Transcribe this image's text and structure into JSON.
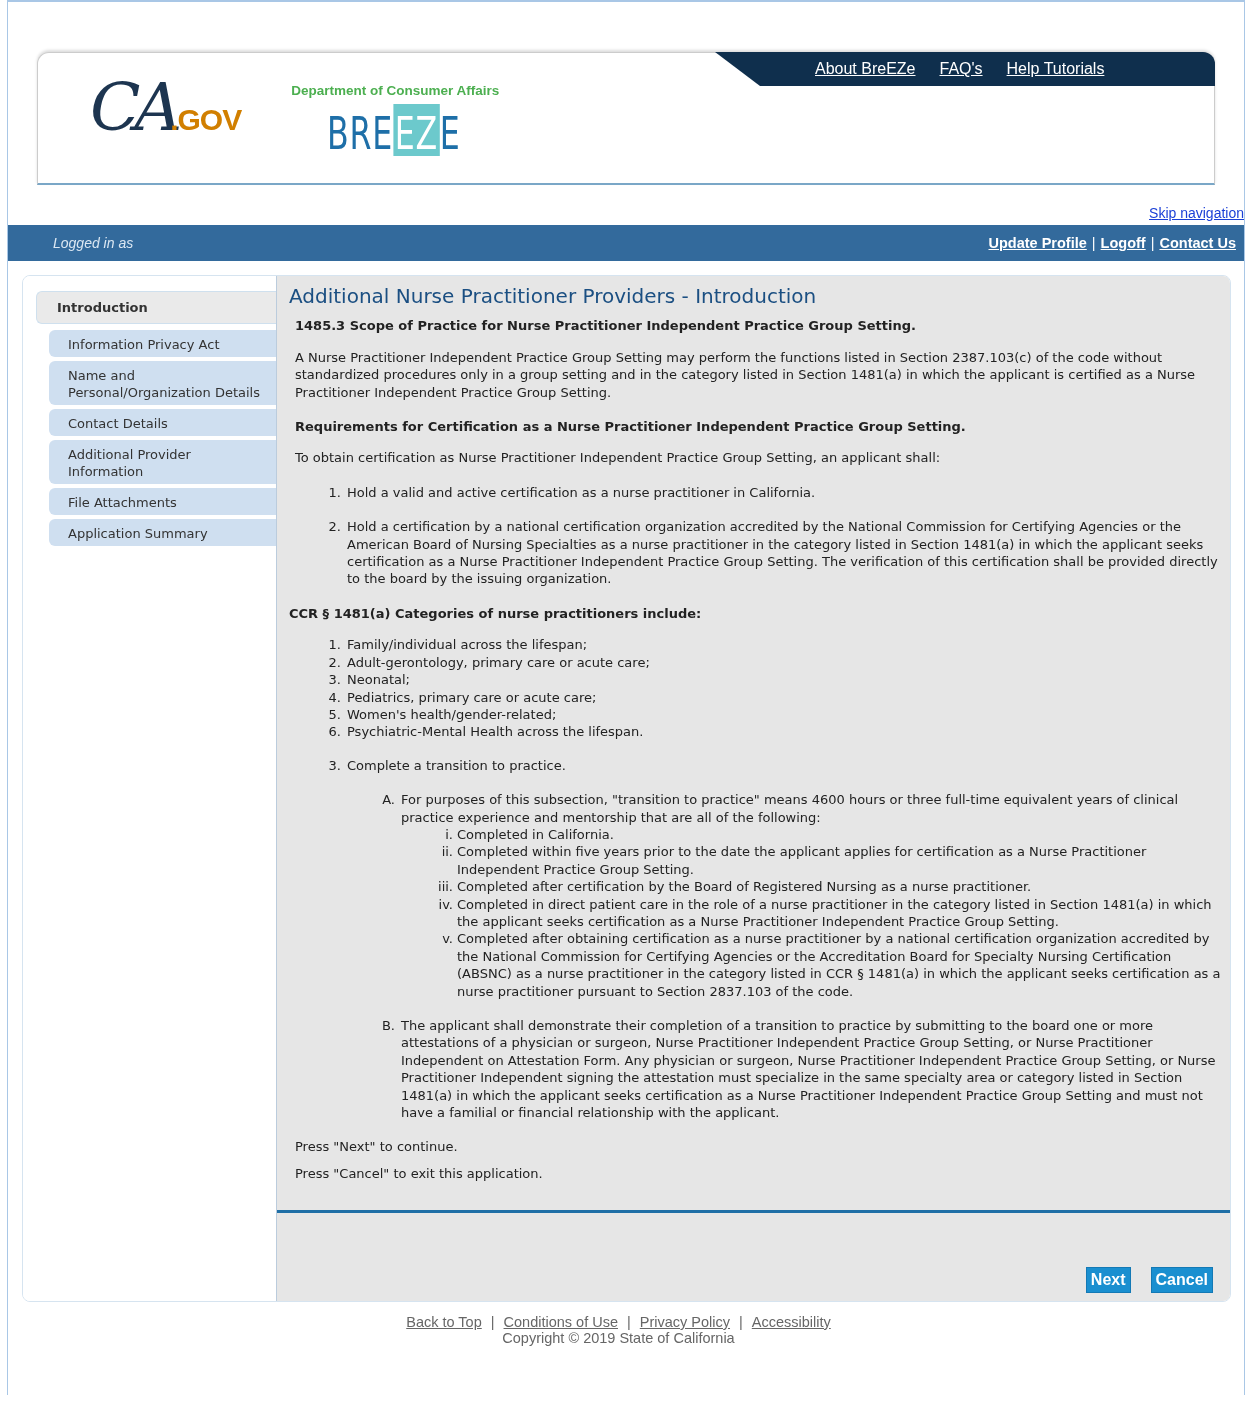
{
  "header": {
    "nav_links": [
      "About BreEZe",
      "FAQ's",
      "Help Tutorials"
    ],
    "ca_logo": {
      "script": "CA",
      "suffix": ".GOV"
    },
    "department": "Department of Consumer Affairs",
    "breeze_logo": {
      "left": "BRE",
      "middle": "EZ",
      "right": "E"
    }
  },
  "skip_link": "Skip navigation",
  "user_bar": {
    "logged_in": "Logged in as",
    "links": [
      "Update Profile",
      "Logoff",
      "Contact Us"
    ],
    "separator": "|"
  },
  "sidebar": {
    "items": [
      {
        "label": "Introduction",
        "selected": true
      },
      {
        "label": "Information Privacy Act",
        "selected": false
      },
      {
        "label": "Name and Personal/Organization Details",
        "selected": false
      },
      {
        "label": "Contact Details",
        "selected": false
      },
      {
        "label": "Additional Provider Information",
        "selected": false
      },
      {
        "label": "File Attachments",
        "selected": false
      },
      {
        "label": "Application Summary",
        "selected": false
      }
    ]
  },
  "content": {
    "title": "Additional Nurse Practitioner Providers - Introduction",
    "scope_heading": "1485.3 Scope of Practice for Nurse Practitioner Independent Practice Group Setting.",
    "scope_text": "A Nurse Practitioner Independent Practice Group Setting may perform the functions listed in Section 2387.103(c) of the code without standardized procedures only in a group setting and in the category listed in Section 1481(a) in which the applicant is certified as a Nurse Practitioner Independent Practice Group Setting.",
    "requirements_heading": "Requirements for Certification as a Nurse Practitioner Independent Practice Group Setting.",
    "requirements_intro": "To obtain certification as Nurse Practitioner Independent Practice Group Setting, an applicant shall:",
    "requirements": [
      {
        "marker": "1.",
        "text": "Hold a valid and active certification as a nurse practitioner in California."
      },
      {
        "marker": "2.",
        "text": "Hold a certification by a national certification organization accredited by the National Commission for Certifying Agencies or the American Board of Nursing Specialties as a nurse practitioner in the category listed in Section 1481(a) in which the applicant seeks certification as a Nurse Practitioner Independent Practice Group Setting. The verification of this certification shall be provided directly to the board by the issuing organization."
      }
    ],
    "categories_heading": "CCR § 1481(a) Categories of nurse practitioners include:",
    "categories": [
      {
        "marker": "1.",
        "text": "Family/individual across the lifespan;"
      },
      {
        "marker": "2.",
        "text": "Adult-gerontology, primary care or acute care;"
      },
      {
        "marker": "3.",
        "text": "Neonatal;"
      },
      {
        "marker": "4.",
        "text": "Pediatrics, primary care or acute care;"
      },
      {
        "marker": "5.",
        "text": "Women's health/gender-related;"
      },
      {
        "marker": "6.",
        "text": "Psychiatric-Mental Health across the lifespan."
      }
    ],
    "requirement_3": {
      "marker": "3.",
      "text": "Complete a transition to practice."
    },
    "sub_items": [
      {
        "marker": "A.",
        "text": "For purposes of this subsection, \"transition to practice\" means 4600 hours or three full-time equivalent years of clinical practice experience and mentorship that are all of the following:",
        "children": [
          {
            "marker": "i.",
            "text": "Completed in California."
          },
          {
            "marker": "ii.",
            "text": "Completed within five years prior to the date the applicant applies for certification as a Nurse Practitioner Independent Practice Group Setting."
          },
          {
            "marker": "iii.",
            "text": "Completed after certification by the Board of Registered Nursing as a nurse practitioner."
          },
          {
            "marker": "iv.",
            "text": "Completed in direct patient care in the role of a nurse practitioner in the category listed in Section 1481(a) in which the applicant seeks certification as a Nurse Practitioner Independent Practice Group Setting."
          },
          {
            "marker": "v.",
            "text": "Completed after obtaining certification as a nurse practitioner by a national certification organization accredited by the National Commission for Certifying Agencies or the Accreditation Board for Specialty Nursing Certification (ABSNC) as a nurse practitioner in the category listed in CCR § 1481(a) in which the applicant seeks certification as a nurse practitioner pursuant to Section 2837.103 of the code."
          }
        ]
      },
      {
        "marker": "B.",
        "text": "The applicant shall demonstrate their completion of a transition to practice by submitting to the board one or more attestations of a physician or surgeon, Nurse Practitioner Independent Practice Group Setting, or Nurse Practitioner Independent on Attestation Form. Any physician or surgeon, Nurse Practitioner Independent Practice Group Setting, or Nurse Practitioner Independent signing the attestation must specialize in the same specialty area or category listed in Section 1481(a) in which the applicant seeks certification as a Nurse Practitioner Independent Practice Group Setting and must not have a familial or financial relationship with the applicant."
      }
    ],
    "closing": [
      "Press \"Next\" to continue.",
      "Press \"Cancel\" to exit this application."
    ]
  },
  "buttons": [
    "Next",
    "Cancel"
  ],
  "footer": {
    "links": [
      "Back to Top",
      "Conditions of Use",
      "Privacy Policy",
      "Accessibility"
    ],
    "separator": "|",
    "copyright": "Copyright © 2019 State of California"
  }
}
